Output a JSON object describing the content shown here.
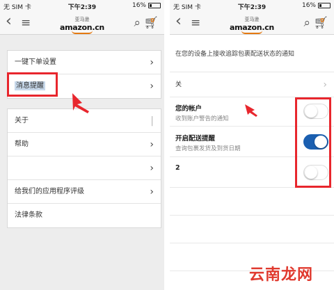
{
  "status": {
    "carrier": "无 SIM 卡",
    "time": "下午2:39",
    "battery": "16%"
  },
  "nav": {
    "logo_cn": "亚马逊",
    "logo_text": "amazon",
    "logo_suffix": ".cn",
    "cart_count": "0"
  },
  "left_screen": {
    "group1": [
      {
        "label": "一键下单设置"
      },
      {
        "label": "消息提醒"
      }
    ],
    "group2": [
      {
        "label": "关于"
      },
      {
        "label": "帮助"
      },
      {
        "label": ""
      },
      {
        "label": "给我们的应用程序评级"
      },
      {
        "label": "法律条款"
      }
    ]
  },
  "right_screen": {
    "description": "在您的设备上接收追踪包裹配送状态的通知",
    "row_off_label": "关",
    "toggles": [
      {
        "title": "您的帐户",
        "subtitle": "收到账户警告的通知",
        "on": false
      },
      {
        "title": "开启配送提醒",
        "subtitle": "查询包裹发货及到货日期",
        "on": true
      },
      {
        "title": "2",
        "subtitle": "",
        "on": false
      }
    ]
  },
  "watermark": "云南龙网",
  "colors": {
    "accent_red": "#e8262d",
    "toggle_on": "#1b5fb0",
    "amazon_orange": "#e47911"
  }
}
